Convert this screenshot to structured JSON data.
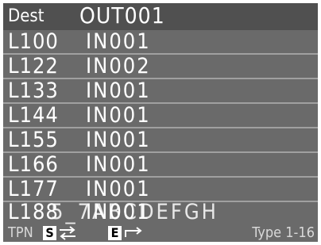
{
  "header": {
    "label": "Dest",
    "destination": "OUT001"
  },
  "rows": [
    {
      "name": "L100",
      "source": "IN001"
    },
    {
      "name": "L122",
      "source": "IN002"
    },
    {
      "name": "L133",
      "source": "IN001"
    },
    {
      "name": "L144",
      "source": "IN001"
    },
    {
      "name": "L155",
      "source": "IN001"
    },
    {
      "name": "L166",
      "source": "IN001"
    },
    {
      "name": "L177",
      "source": "IN001"
    }
  ],
  "overlap_row": {
    "name": "L188",
    "source": "IN001",
    "alias": "5_7ABCDEFGH"
  },
  "footer": {
    "tpn": "TPN",
    "s_label": "S",
    "e_label": "E",
    "s_icon": "swap-arrows-icon",
    "e_icon": "return-arrow-icon",
    "type": "Type 1-16"
  },
  "colors": {
    "background": "#6a6a6a",
    "header": "#505050",
    "divider": "#a0a0a0",
    "text": "#ffffff"
  }
}
